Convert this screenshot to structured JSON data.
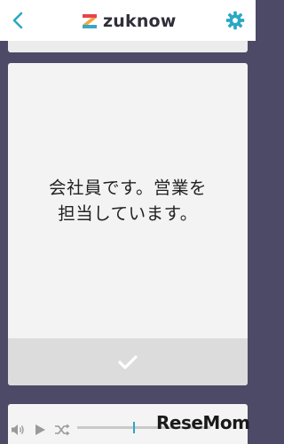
{
  "header": {
    "app_name": "zuknow",
    "icons": {
      "back": "chevron-left-icon",
      "settings": "gear-icon",
      "logo": "zuknow-logo-icon"
    },
    "accent_color": "#2ba8c4"
  },
  "card": {
    "lines": [
      "会社員です。営業を",
      "担当しています。"
    ],
    "confirm_icon": "checkmark-icon"
  },
  "player": {
    "icons": [
      "volume-icon",
      "play-icon",
      "shuffle-icon"
    ],
    "progress": 0.42
  },
  "watermark": {
    "text": "ReseMom"
  },
  "colors": {
    "background": "#4d4a67",
    "card": "#f3f3f3",
    "check_bar": "#dcdcdc",
    "accent": "#2ba8c4"
  }
}
